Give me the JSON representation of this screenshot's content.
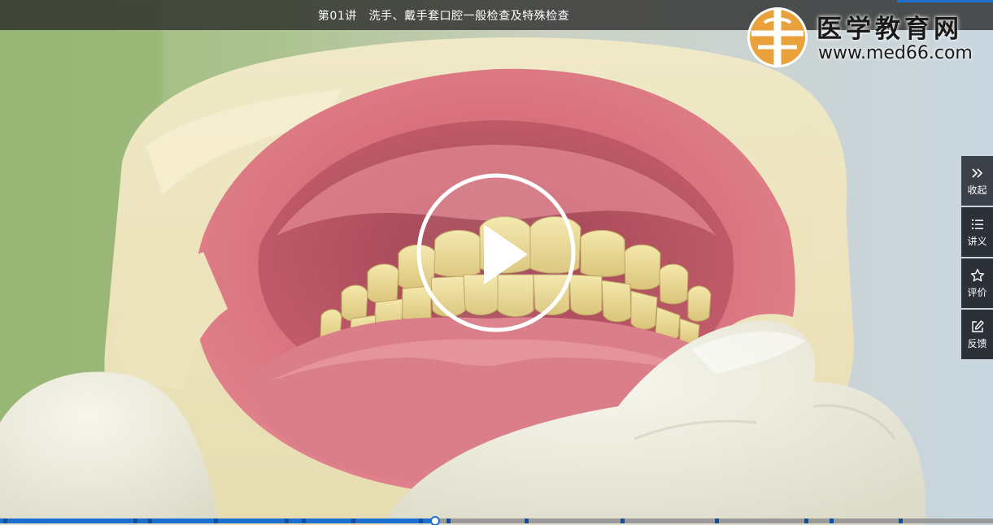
{
  "player": {
    "title": "第01讲   洗手、戴手套口腔一般检查及特殊检查",
    "state": "paused",
    "progress_fraction": 0.438,
    "chapter_marks": [
      0.003,
      0.134,
      0.149,
      0.215,
      0.287,
      0.304,
      0.354,
      0.422,
      0.45,
      0.528,
      0.625,
      0.72,
      0.81,
      0.835,
      0.905
    ]
  },
  "logo": {
    "name": "医学教育网",
    "url": "www.med66.com",
    "seal_colors": [
      "#e9a23b",
      "#ffffff"
    ]
  },
  "side_panel": {
    "items": [
      {
        "label": "收起",
        "icon": "double-chevron-right-icon"
      },
      {
        "label": "讲义",
        "icon": "list-icon"
      },
      {
        "label": "评价",
        "icon": "star-icon"
      },
      {
        "label": "反馈",
        "icon": "edit-icon"
      }
    ]
  },
  "colors": {
    "accent": "#1a6fd1",
    "panel": "#2c3037",
    "title_bar": "#262626"
  }
}
